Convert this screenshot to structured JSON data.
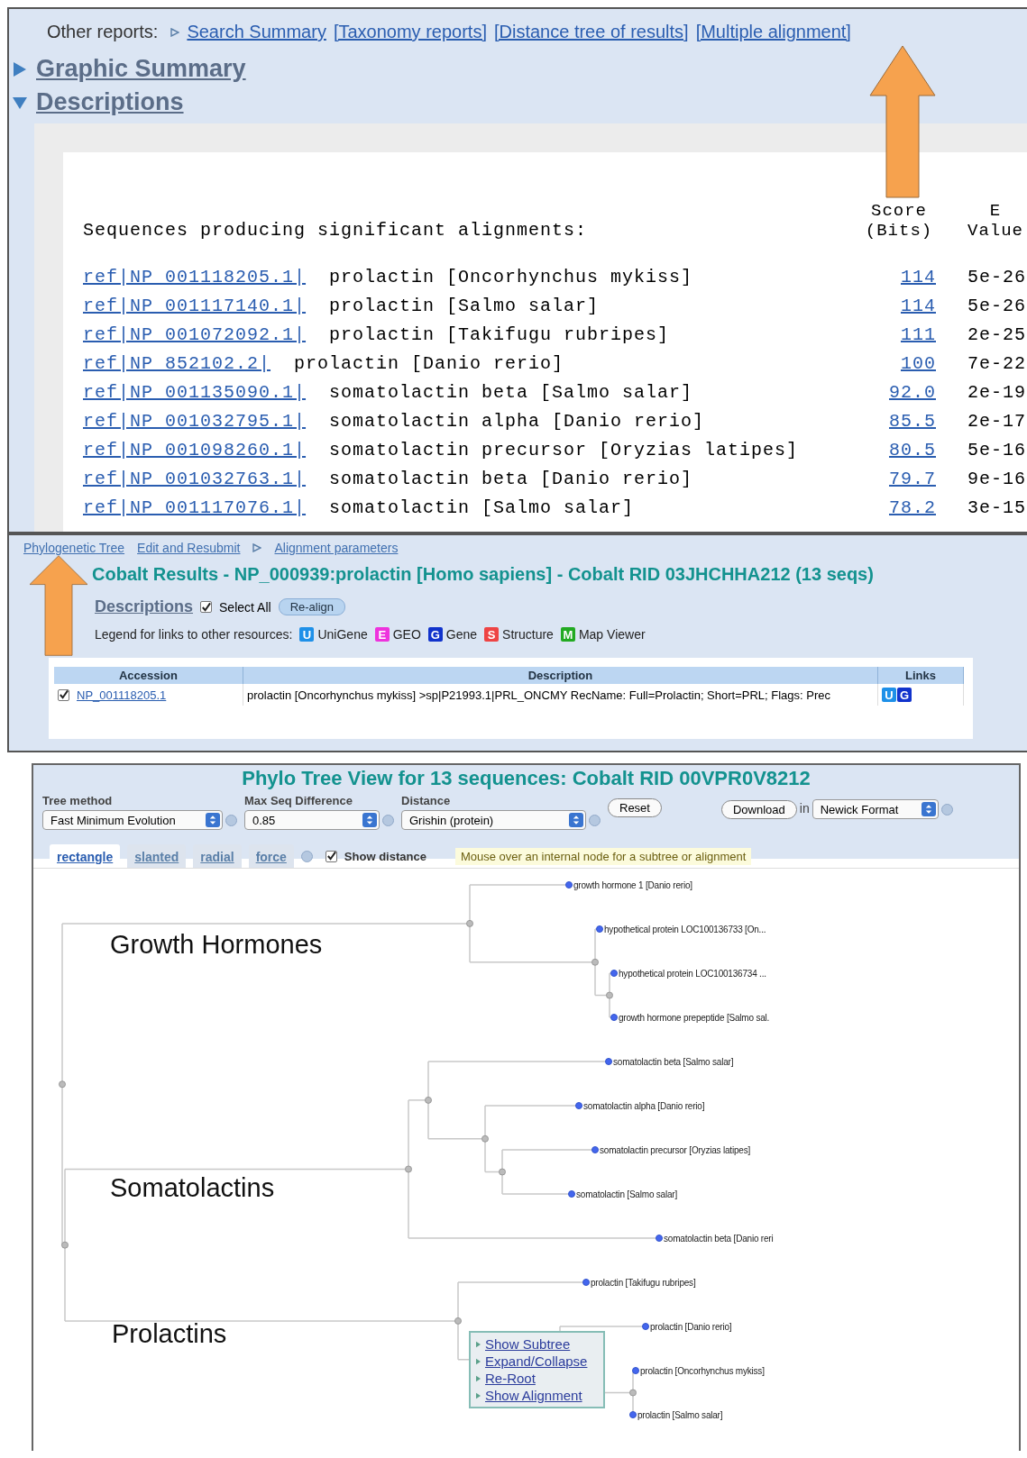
{
  "report_panel": {
    "other_reports_label": "Other reports:",
    "other_reports": [
      {
        "label": "Search Summary",
        "marker": true
      },
      {
        "label": "[Taxonomy reports]",
        "marker": false
      },
      {
        "label": "[Distance tree of results]",
        "marker": false
      },
      {
        "label": "[Multiple alignment]",
        "marker": false
      }
    ],
    "sections": [
      {
        "title": "Graphic Summary",
        "expanded": false
      },
      {
        "title": "Descriptions",
        "expanded": true
      }
    ],
    "descriptions": {
      "heading": "Sequences producing significant alignments:",
      "score_header": [
        "Score",
        "(Bits)"
      ],
      "evalue_header": [
        "E",
        "Value"
      ],
      "rows": [
        {
          "accession": "ref|NP 001118205.1|",
          "description": "prolactin [Oncorhynchus mykiss]",
          "score": "114",
          "evalue": "5e-26"
        },
        {
          "accession": "ref|NP 001117140.1|",
          "description": "prolactin [Salmo salar]",
          "score": "114",
          "evalue": "5e-26"
        },
        {
          "accession": "ref|NP 001072092.1|",
          "description": "prolactin [Takifugu rubripes]",
          "score": "111",
          "evalue": "2e-25"
        },
        {
          "accession": "ref|NP 852102.2|",
          "description": "prolactin [Danio rerio]",
          "score": "100",
          "evalue": "7e-22"
        },
        {
          "accession": "ref|NP 001135090.1|",
          "description": "somatolactin beta [Salmo salar]",
          "score": "92.0",
          "evalue": "2e-19"
        },
        {
          "accession": "ref|NP 001032795.1|",
          "description": "somatolactin alpha [Danio rerio]",
          "score": "85.5",
          "evalue": "2e-17"
        },
        {
          "accession": "ref|NP 001098260.1|",
          "description": "somatolactin precursor [Oryzias latipes]",
          "score": "80.5",
          "evalue": "5e-16"
        },
        {
          "accession": "ref|NP 001032763.1|",
          "description": "somatolactin beta [Danio rerio]",
          "score": "79.7",
          "evalue": "9e-16"
        },
        {
          "accession": "ref|NP 001117076.1|",
          "description": "somatolactin [Salmo salar]",
          "score": "78.2",
          "evalue": "3e-15"
        }
      ]
    }
  },
  "cobalt": {
    "links": [
      {
        "label": "Phylogenetic Tree",
        "marker": false
      },
      {
        "label": "Edit and Resubmit",
        "marker": false
      },
      {
        "label": "Alignment parameters",
        "marker": true
      }
    ],
    "title": "Cobalt Results - NP_000939:prolactin [Homo sapiens] - Cobalt RID 03JHCHHA212 (13 seqs)",
    "descriptions_label": "Descriptions",
    "select_all": {
      "label": "Select All",
      "checked": true
    },
    "realign": "Re-align",
    "legend_label": "Legend for links to other resources:",
    "legend": [
      {
        "letter": "U",
        "label": "UniGene",
        "color": "#1e90e8"
      },
      {
        "letter": "E",
        "label": "GEO",
        "color": "#ee33dd"
      },
      {
        "letter": "G",
        "label": "Gene",
        "color": "#1133cc"
      },
      {
        "letter": "S",
        "label": "Structure",
        "color": "#ee4444"
      },
      {
        "letter": "M",
        "label": "Map Viewer",
        "color": "#22aa22"
      }
    ],
    "table": {
      "columns": [
        "Accession",
        "Description",
        "Links"
      ],
      "rows": [
        {
          "checked": true,
          "accession": "NP_001118205.1",
          "description": "prolactin [Oncorhynchus mykiss] >sp|P21993.1|PRL_ONCMY RecName: Full=Prolactin; Short=PRL; Flags: Prec",
          "links": [
            {
              "letter": "U",
              "color": "#1e90e8"
            },
            {
              "letter": "G",
              "color": "#1133cc"
            }
          ]
        }
      ]
    }
  },
  "phylo": {
    "title": "Phylo Tree View for 13 sequences: Cobalt RID 00VPR0V8212",
    "controls": [
      {
        "label": "Tree method",
        "value": "Fast Minimum Evolution"
      },
      {
        "label": "Max Seq Difference",
        "value": "0.85"
      },
      {
        "label": "Distance",
        "value": "Grishin (protein)"
      }
    ],
    "reset": "Reset",
    "download": "Download",
    "in": "in",
    "format": "Newick Format",
    "views": [
      {
        "label": "rectangle",
        "selected": true
      },
      {
        "label": "slanted",
        "selected": false
      },
      {
        "label": "radial",
        "selected": false
      },
      {
        "label": "force",
        "selected": false
      }
    ],
    "show_distance": {
      "label": "Show distance",
      "checked": true
    },
    "hint": "Mouse over an internal node for a subtree or alignment",
    "group_labels": [
      "Growth Hormones",
      "Somatolactins",
      "Prolactins"
    ],
    "tree": {
      "children": [
        {
          "children": [
            {
              "label": "growth hormone 1 [Danio rerio]"
            },
            {
              "children": [
                {
                  "label": "hypothetical protein LOC100136733 [On..."
                },
                {
                  "children": [
                    {
                      "label": "hypothetical protein LOC100136734 ..."
                    },
                    {
                      "label": "growth hormone prepeptide [Salmo sal."
                    }
                  ]
                }
              ]
            }
          ]
        },
        {
          "children": [
            {
              "children": [
                {
                  "children": [
                    {
                      "label": "somatolactin beta [Salmo salar]"
                    },
                    {
                      "children": [
                        {
                          "label": "somatolactin alpha [Danio rerio]"
                        },
                        {
                          "children": [
                            {
                              "label": "somatolactin precursor [Oryzias latipes]"
                            },
                            {
                              "label": "somatolactin [Salmo salar]"
                            }
                          ]
                        }
                      ]
                    }
                  ]
                },
                {
                  "label": "somatolactin beta [Danio reri"
                }
              ]
            },
            {
              "children": [
                {
                  "label": "prolactin [Takifugu rubripes]"
                },
                {
                  "children": [
                    {
                      "label": "prolactin [Danio rerio]"
                    },
                    {
                      "children": [
                        {
                          "label": "prolactin [Oncorhynchus mykiss]"
                        },
                        {
                          "label": "prolactin [Salmo salar]"
                        }
                      ]
                    }
                  ]
                }
              ]
            }
          ]
        }
      ]
    },
    "context_menu": [
      "Show Subtree",
      "Expand/Collapse",
      "Re-Root",
      "Show Alignment"
    ]
  }
}
